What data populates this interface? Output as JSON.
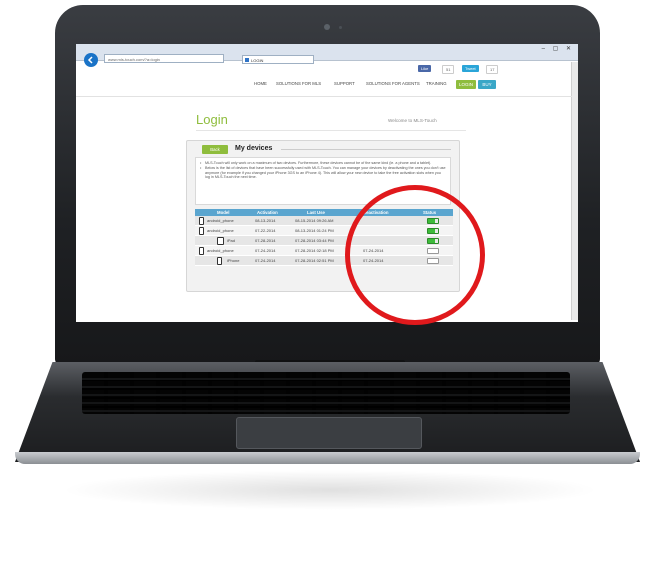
{
  "browser": {
    "address": "www.mls-touch.com/?a=login",
    "tab_title": "LOGIN",
    "window_controls": "– ▢ ✕"
  },
  "social": {
    "like_label": "Like",
    "like_count": "51",
    "tweet_label": "Tweet",
    "tweet_count": "17"
  },
  "nav": {
    "items": [
      "HOME",
      "SOLUTIONS FOR MLS",
      "SUPPORT",
      "SOLUTIONS FOR AGENTS",
      "TRAINING"
    ],
    "login": "LOGIN",
    "buy": "BUY"
  },
  "page": {
    "title": "Login",
    "welcome": "Welcome to MLS-Touch"
  },
  "panel": {
    "back_button": "Back",
    "title": "My devices",
    "notes": [
      "MLS-Touch will only work on a maximum of two devices. Furthermore, these devices cannot be of the same kind (ie. a phone and a tablet).",
      "Below is the list of devices that have been successfully used with MLS-Touch. You can manage your devices by deactivating the ones you don't use anymore (for example if you changed your iPhone 3GS to an iPhone 4). This will allow your new device to take the free activation slots when you log in MLS-Touch the next time."
    ]
  },
  "table": {
    "headers": [
      "Model",
      "Activation",
      "Last Use",
      "Deactivation",
      "Status"
    ],
    "rows": [
      {
        "model": "android_phone",
        "activation": "08-13-2014",
        "last_use": "08-15-2014 09:26 AM",
        "deactivation": "",
        "status_on": true,
        "icon": "phone"
      },
      {
        "model": "android_phone",
        "activation": "07-22-2014",
        "last_use": "08-13-2014 01:24 PM",
        "deactivation": "",
        "status_on": true,
        "icon": "phone"
      },
      {
        "model": "iPad",
        "activation": "07-28-2014",
        "last_use": "07-28-2014 03:44 PM",
        "deactivation": "",
        "status_on": true,
        "icon": "tablet"
      },
      {
        "model": "android_phone",
        "activation": "07-24-2014",
        "last_use": "07-28-2014 02:18 PM",
        "deactivation": "07-24-2014",
        "status_on": false,
        "icon": "phone"
      },
      {
        "model": "iPhone",
        "activation": "07-24-2014",
        "last_use": "07-28-2014 02:51 PM",
        "deactivation": "07-24-2014",
        "status_on": false,
        "icon": "phone"
      }
    ]
  },
  "colors": {
    "accent_green": "#8fbd3d",
    "table_header": "#5aa5cf",
    "status_on": "#3dbb3a",
    "highlight_circle": "#e0191c"
  },
  "icons": {
    "back": "back-arrow-icon",
    "phone": "phone-icon",
    "tablet": "tablet-icon"
  }
}
